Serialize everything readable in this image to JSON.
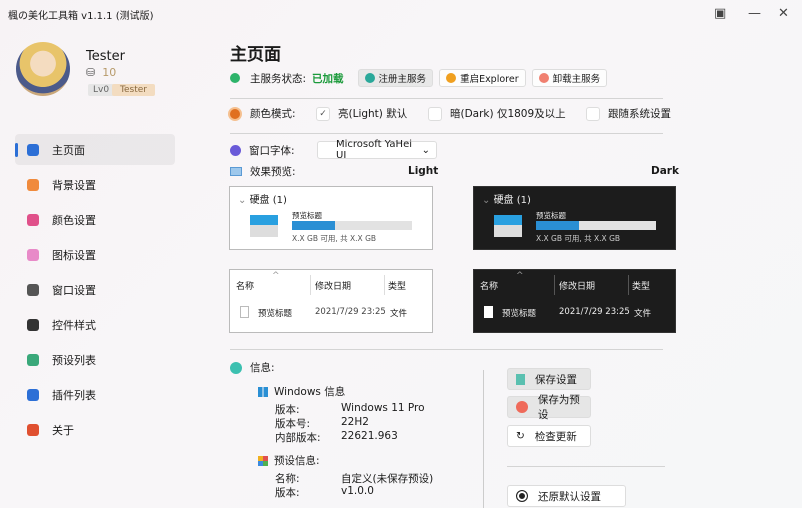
{
  "window": {
    "title": "楓の美化工具箱 v1.1.1 (测试版)",
    "save_icon": "save-icon",
    "minimize_icon": "—",
    "close_icon": "✕"
  },
  "user": {
    "name": "Tester",
    "coins": "10",
    "level": "Lv0",
    "tag": "Tester"
  },
  "sidebar": {
    "items": [
      {
        "label": "主页面",
        "icon": "home-icon",
        "color": "#2c6fd6"
      },
      {
        "label": "背景设置",
        "icon": "image-icon",
        "color": "#f08a3c"
      },
      {
        "label": "颜色设置",
        "icon": "palette-icon",
        "color": "#e0508a"
      },
      {
        "label": "图标设置",
        "icon": "star-icon",
        "color": "#e88ac8"
      },
      {
        "label": "窗口设置",
        "icon": "window-icon",
        "color": "#555"
      },
      {
        "label": "控件样式",
        "icon": "controls-icon",
        "color": "#333"
      },
      {
        "label": "预设列表",
        "icon": "list-icon",
        "color": "#3aa87a"
      },
      {
        "label": "插件列表",
        "icon": "plugin-icon",
        "color": "#2c6fd6"
      },
      {
        "label": "关于",
        "icon": "info-icon",
        "color": "#e05030"
      }
    ]
  },
  "main": {
    "title": "主页面",
    "service": {
      "label": "主服务状态:",
      "status": "已加载",
      "status_color": "#1a9a3a",
      "buttons": [
        "注册主服务",
        "重启Explorer",
        "卸载主服务"
      ]
    },
    "color_mode": {
      "label": "颜色模式:",
      "options": [
        {
          "label": "亮(Light) 默认",
          "checked": true
        },
        {
          "label": "暗(Dark) 仅1809及以上",
          "checked": false
        },
        {
          "label": "跟随系统设置",
          "checked": false
        }
      ]
    },
    "font": {
      "label": "窗口字体:",
      "value": "Microsoft YaHei UI"
    },
    "preview": {
      "label": "效果预览:",
      "light": "Light",
      "dark": "Dark",
      "disk": {
        "group": "硬盘 (1)",
        "name": "预览标题",
        "usage": "X.X GB 可用, 共 X.X GB",
        "fill": 0.36
      },
      "list": {
        "headers": [
          "名称",
          "修改日期",
          "类型"
        ],
        "row": [
          "预览标题",
          "2021/7/29 23:25",
          "文件"
        ]
      }
    },
    "info": {
      "label": "信息:",
      "windows_title": "Windows 信息",
      "windows": [
        [
          "版本:",
          "Windows 11 Pro"
        ],
        [
          "版本号:",
          "22H2"
        ],
        [
          "内部版本:",
          "22621.963"
        ]
      ],
      "preset_title": "预设信息:",
      "preset": [
        [
          "名称:",
          "自定义(未保存预设)"
        ],
        [
          "版本:",
          "v1.0.0"
        ]
      ]
    },
    "actions": {
      "save": "保存设置",
      "save_preset": "保存为预设",
      "check_update": "检查更新",
      "restore": "还原默认设置"
    }
  }
}
